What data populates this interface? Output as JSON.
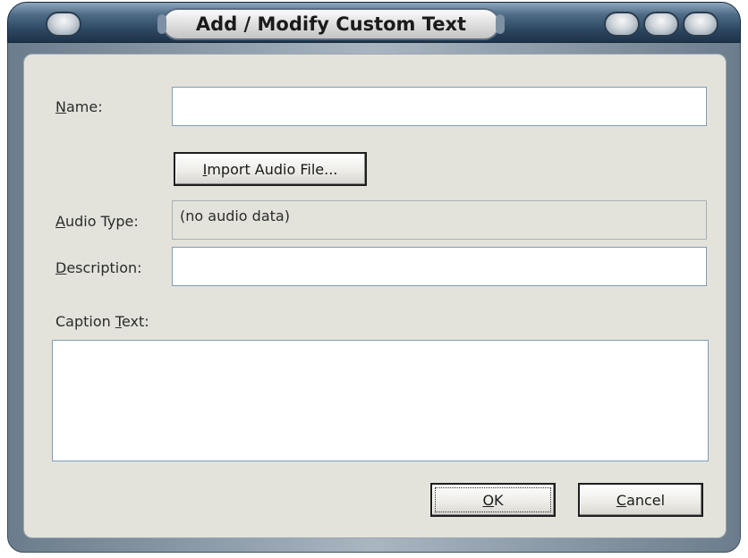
{
  "window": {
    "title": "Add / Modify Custom Text"
  },
  "form": {
    "name_label_u": "N",
    "name_label_rest": "ame:",
    "name_value": "",
    "import_button_u": "I",
    "import_button_rest": "mport Audio File...",
    "audio_type_label_u": "A",
    "audio_type_label_rest": "udio Type:",
    "audio_type_value": "(no audio data)",
    "description_label_u": "D",
    "description_label_rest": "escription:",
    "description_value": "",
    "caption_label_pre": "Caption ",
    "caption_label_u": "T",
    "caption_label_rest": "ext:",
    "caption_value": ""
  },
  "buttons": {
    "ok_u": "O",
    "ok_rest": "K",
    "cancel_u": "C",
    "cancel_rest": "ancel"
  }
}
